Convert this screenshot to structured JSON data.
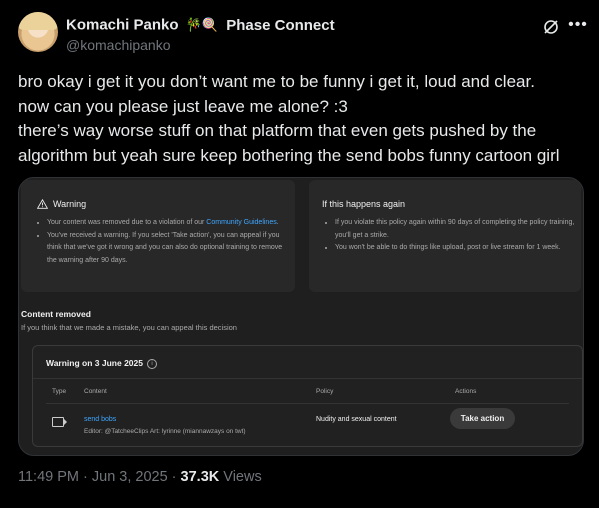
{
  "author": {
    "name": "Komachi Panko",
    "emojis": "🎋🍭",
    "affiliation": "Phase Connect",
    "handle": "@komachipanko"
  },
  "tweet_lines": [
    "bro okay i get it you don’t want me to be funny i get it, loud and clear.",
    "now can you please just leave me alone? :3",
    "there’s way worse stuff on that platform that even gets pushed by the",
    "algorithm but yeah sure keep bothering the send bobs funny cartoon girl"
  ],
  "screenshot": {
    "warning_panel": {
      "title": "Warning",
      "item1_pre": "Your content was removed due to a violation of our ",
      "item1_link": "Community Guidelines",
      "item1_post": ".",
      "item2": "You've received a warning. If you select 'Take action', you can appeal if you think that we've got it wrong and you can also do optional training to remove the warning after 90 days."
    },
    "again_panel": {
      "title": "If this happens again",
      "item1": "If you violate this policy again within 90 days of completing the policy training, you'll get a strike.",
      "item2": "You won't be able to do things like upload, post or live stream for 1 week."
    },
    "content_removed_title": "Content removed",
    "content_removed_sub": "If you think that we made a mistake, you can appeal this decision",
    "warning_box": {
      "heading": "Warning on 3 June 2025",
      "info_icon_glyph": "i",
      "columns": {
        "type": "Type",
        "content": "Content",
        "policy": "Policy",
        "actions": "Actions"
      },
      "row": {
        "title": "send bobs",
        "subtitle": "Editor: @TatcheeClips Art: lyrinne (miannawzays on twt)",
        "policy": "Nudity and sexual content",
        "action_label": "Take action"
      }
    }
  },
  "footer": {
    "time": "11:49 PM · Jun 3, 2025 · ",
    "views_count": "37.3K",
    "views_label": " Views"
  },
  "colors": {
    "link": "#3ea6ff",
    "muted": "#71767b",
    "text": "#e7e9ea"
  }
}
